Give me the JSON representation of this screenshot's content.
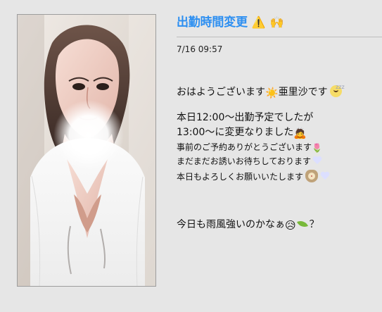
{
  "post": {
    "title": "出勤時間変更",
    "title_icons": [
      "warning-icon",
      "raised-hands-icon"
    ],
    "timestamp": "7/16 09:57",
    "body": {
      "line1": "おはようございます",
      "line1_name": "亜里沙です",
      "line2": "本日12:00〜出勤予定でしたが",
      "line3": "13:00〜に変更なりました",
      "line4": "事前のご予約ありがとうございます",
      "line5": "まだまだお誘いお待ちしております",
      "line6": "本日もよろしくお願いいたします",
      "line7": "今日も雨風強いのかなぁ",
      "line7_end": "？"
    }
  },
  "colors": {
    "title": "#2d8ff1",
    "background": "#e6e6e6",
    "divider": "#bdbdbd"
  }
}
